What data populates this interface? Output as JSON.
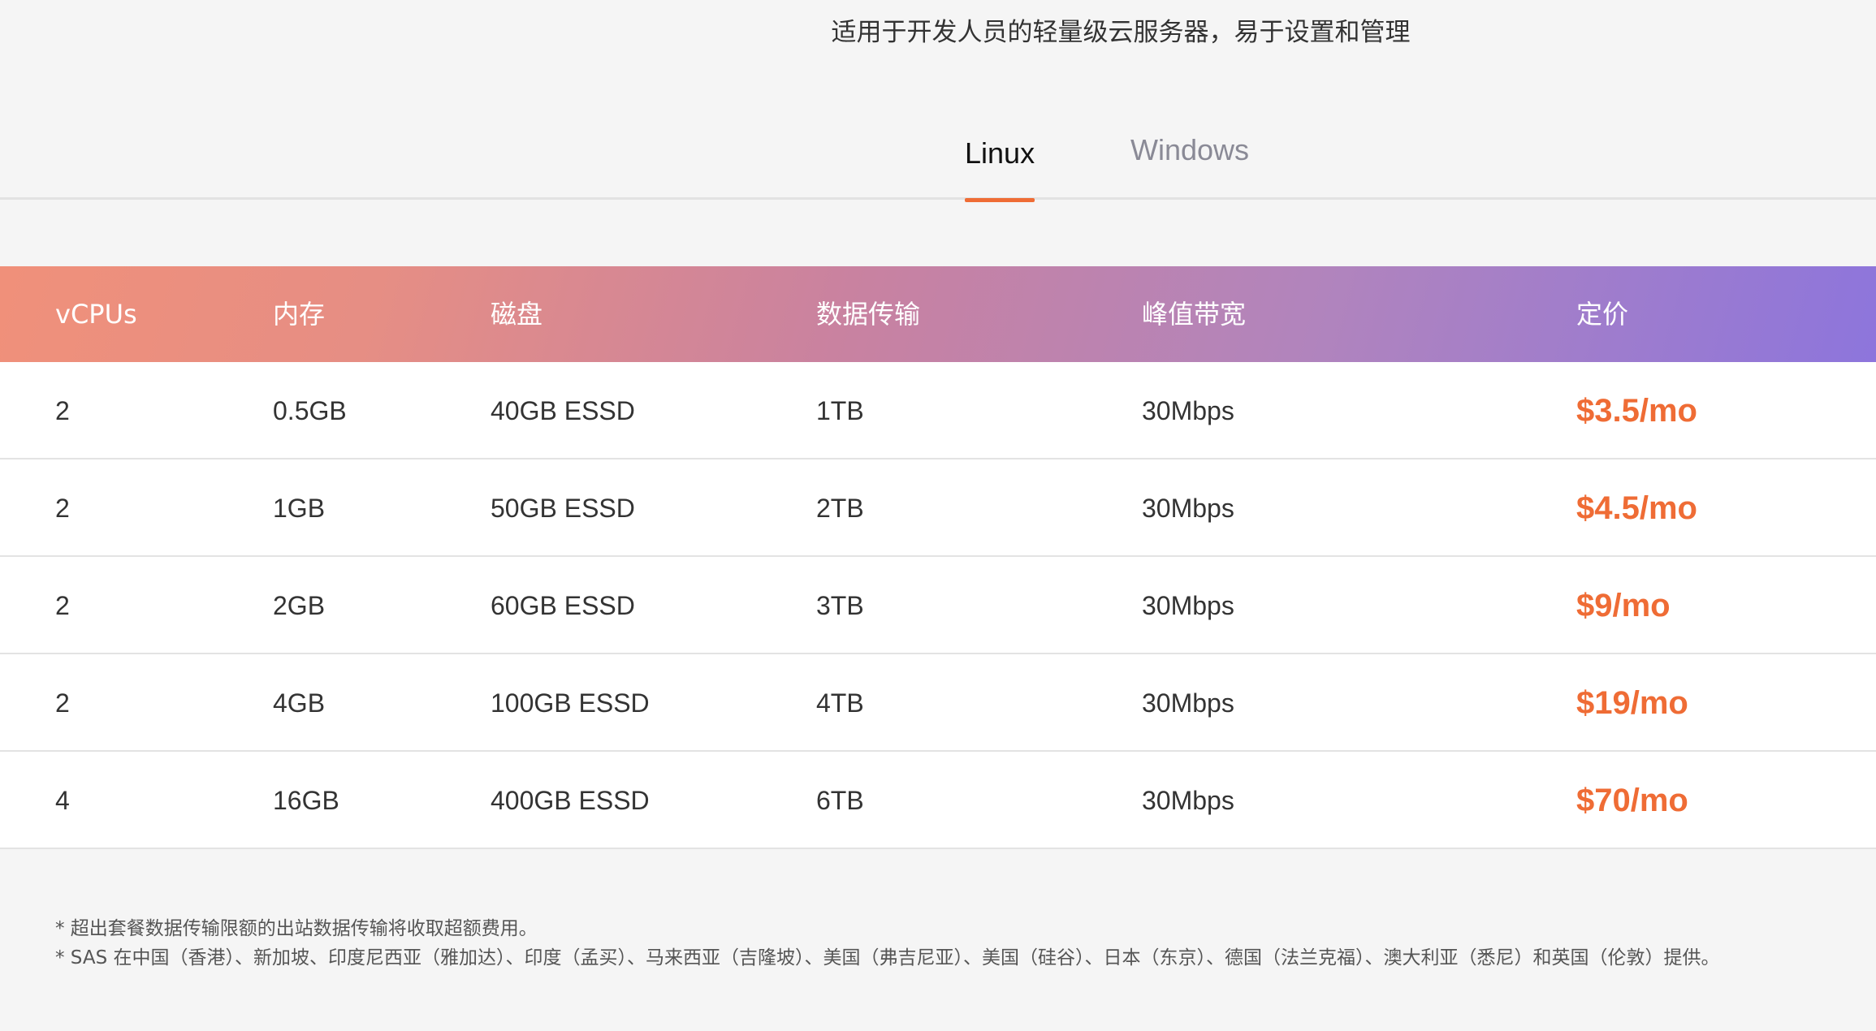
{
  "header": {
    "subtitle": "适用于开发人员的轻量级云服务器，易于设置和管理"
  },
  "tabs": [
    {
      "label": "Linux",
      "active": true
    },
    {
      "label": "Windows",
      "active": false
    }
  ],
  "accent_color": "#ef6c35",
  "pricing_table": {
    "columns": [
      "vCPUs",
      "内存",
      "磁盘",
      "数据传输",
      "峰值带宽",
      "定价"
    ],
    "rows": [
      {
        "vcpus": "2",
        "memory": "0.5GB",
        "disk": "40GB ESSD",
        "transfer": "1TB",
        "bandwidth": "30Mbps",
        "price": "$3.5/mo"
      },
      {
        "vcpus": "2",
        "memory": "1GB",
        "disk": "50GB ESSD",
        "transfer": "2TB",
        "bandwidth": "30Mbps",
        "price": "$4.5/mo"
      },
      {
        "vcpus": "2",
        "memory": "2GB",
        "disk": "60GB ESSD",
        "transfer": "3TB",
        "bandwidth": "30Mbps",
        "price": "$9/mo"
      },
      {
        "vcpus": "2",
        "memory": "4GB",
        "disk": "100GB ESSD",
        "transfer": "4TB",
        "bandwidth": "30Mbps",
        "price": "$19/mo"
      },
      {
        "vcpus": "4",
        "memory": "16GB",
        "disk": "400GB ESSD",
        "transfer": "6TB",
        "bandwidth": "30Mbps",
        "price": "$70/mo"
      }
    ]
  },
  "notes": [
    "* 超出套餐数据传输限额的出站数据传输将收取超额费用。",
    "* SAS 在中国（香港）、新加坡、印度尼西亚（雅加达）、印度（孟买）、马来西亚（吉隆坡）、美国（弗吉尼亚）、美国（硅谷）、日本（东京）、德国（法兰克福）、澳大利亚（悉尼）和英国（伦敦）提供。"
  ]
}
